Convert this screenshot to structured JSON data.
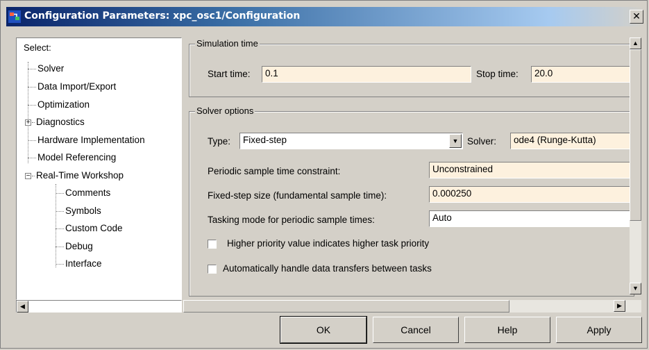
{
  "window": {
    "title": "Configuration Parameters: xpc_osc1/Configuration",
    "close_glyph": "✕"
  },
  "tree": {
    "select_label": "Select:",
    "items": [
      {
        "label": "Solver"
      },
      {
        "label": "Data Import/Export"
      },
      {
        "label": "Optimization"
      },
      {
        "label": "Diagnostics"
      },
      {
        "label": "Hardware Implementation"
      },
      {
        "label": "Model Referencing"
      },
      {
        "label": "Real-Time Workshop"
      },
      {
        "label": "Comments"
      },
      {
        "label": "Symbols"
      },
      {
        "label": "Custom Code"
      },
      {
        "label": "Debug"
      },
      {
        "label": "Interface"
      }
    ],
    "plus": "+",
    "minus": "−"
  },
  "simulation_time": {
    "group_label": "Simulation time",
    "start_label": "Start time:",
    "start_value": "0.1",
    "stop_label": "Stop time:",
    "stop_value": "20.0"
  },
  "solver_options": {
    "group_label": "Solver options",
    "type_label": "Type:",
    "type_value": "Fixed-step",
    "solver_label": "Solver:",
    "solver_value": "ode4 (Runge-Kutta)",
    "periodic_label": "Periodic sample time constraint:",
    "periodic_value": "Unconstrained",
    "step_label": "Fixed-step size (fundamental sample time):",
    "step_value": "0.000250",
    "tasking_label": "Tasking mode for periodic sample times:",
    "tasking_value": "Auto",
    "priority_label": "Higher priority value indicates higher task priority",
    "priority_checked": false,
    "transfer_label": "Automatically handle data transfers between tasks",
    "transfer_checked": false
  },
  "scroll": {
    "up": "▲",
    "down": "▼",
    "left": "◀",
    "right": "▶"
  },
  "buttons": {
    "ok": "OK",
    "cancel": "Cancel",
    "help": "Help",
    "apply": "Apply"
  },
  "colors": {
    "title_start": "#0a246a",
    "field_bg": "#fdf1de",
    "face": "#d4d0c8"
  }
}
